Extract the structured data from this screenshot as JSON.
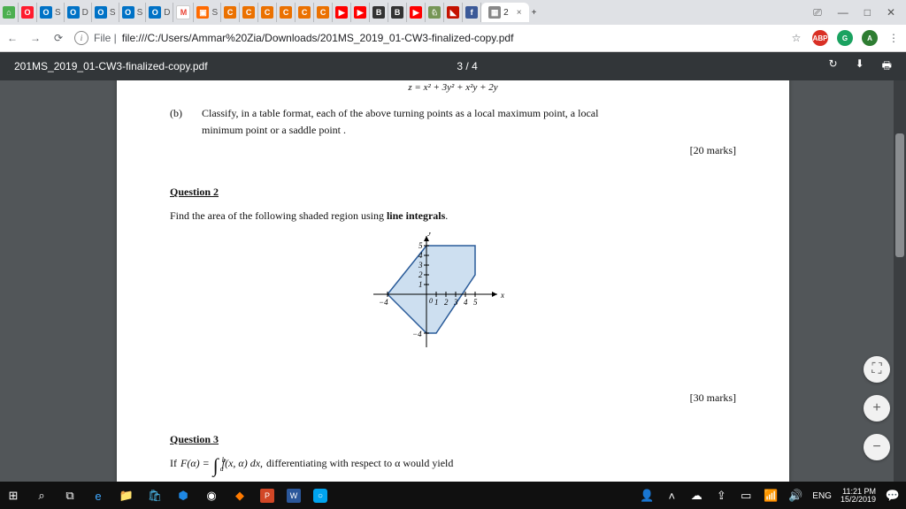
{
  "browser": {
    "open_tab": {
      "label": "2",
      "close": "×"
    },
    "nav": {
      "back": "←",
      "forward": "→",
      "reload": "⟳",
      "url_label": "File |",
      "url": "file:///C:/Users/Ammar%20Zia/Downloads/201MS_2019_01-CW3-finalized-copy.pdf",
      "star": "☆"
    },
    "ext": {
      "abp": "ABP",
      "g": "G",
      "a": "A",
      "menu": "⋮"
    }
  },
  "pdf": {
    "title": "201MS_2019_01-CW3-finalized-copy.pdf",
    "page_indicator": "3 / 4",
    "rotate": "↻",
    "download": "⬇",
    "print": "🖶"
  },
  "doc": {
    "topfrag": "z = x² + 3y² + x²y + 2y",
    "b_label": "(b)",
    "b_text1": "Classify, in a table format, each of the above turning points as a local maximum point, a local",
    "b_text2": "minimum point or a saddle point .",
    "marks20": "[20 marks]",
    "q2": "Question 2",
    "q2_text_prefix": "Find the area of the following shaded region using ",
    "q2_text_bold": "line integrals",
    "q2_text_suffix": ".",
    "axis_y": "y",
    "axis_x": "x",
    "tick5": "5",
    "tick4": "4",
    "tick3": "3",
    "tick2": "2",
    "tick1": "1",
    "tickm4": "−4",
    "tick0": "0",
    "marks30": "[30 marks]",
    "q3": "Question 3",
    "q3_if": "If",
    "q3_func": "F(α) = ",
    "q3_integrand": "f(x, α) dx,",
    "q3_a": "a",
    "q3_b": "b",
    "q3_tail": " differentiating with respect to α would yield"
  },
  "zoom": {
    "fit": "⛶",
    "plus": "+",
    "minus": "−"
  },
  "taskbar": {
    "tray": {
      "people": "👤",
      "up": "˄",
      "cloud": "☁",
      "dropbox": "⇪",
      "battery": "▭",
      "wifi": "📶",
      "vol": "🔊",
      "lang": "ENG",
      "time": "11:21 PM",
      "date": "15/2/2019",
      "notif": "💬"
    }
  }
}
